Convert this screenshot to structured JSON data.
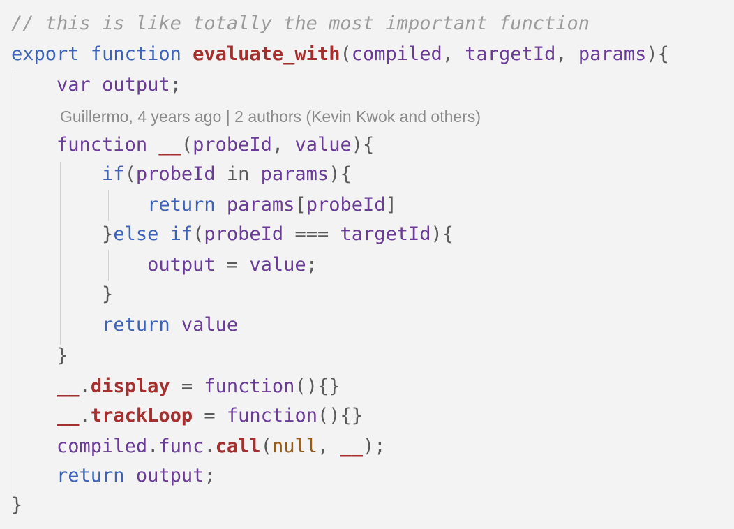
{
  "editor": {
    "blame_annotation": "Guillermo, 4 years ago | 2 authors (Kevin Kwok and others)",
    "lines": [
      [
        {
          "t": "// this is like totally the most important function",
          "c": "comment"
        }
      ],
      [
        {
          "t": "export",
          "c": "kw"
        },
        {
          "t": " ",
          "c": "punc"
        },
        {
          "t": "function",
          "c": "kw"
        },
        {
          "t": " ",
          "c": "punc"
        },
        {
          "t": "evaluate_with",
          "c": "fn"
        },
        {
          "t": "(",
          "c": "punc"
        },
        {
          "t": "compiled",
          "c": "var"
        },
        {
          "t": ", ",
          "c": "punc"
        },
        {
          "t": "targetId",
          "c": "var"
        },
        {
          "t": ", ",
          "c": "punc"
        },
        {
          "t": "params",
          "c": "var"
        },
        {
          "t": "){",
          "c": "punc"
        }
      ],
      [
        {
          "t": "    ",
          "c": "punc"
        },
        {
          "t": "var",
          "c": "var"
        },
        {
          "t": " ",
          "c": "punc"
        },
        {
          "t": "output",
          "c": "var"
        },
        {
          "t": ";",
          "c": "punc"
        }
      ],
      [
        {
          "t": "    ",
          "c": "punc"
        },
        {
          "t": "function",
          "c": "var"
        },
        {
          "t": " ",
          "c": "punc"
        },
        {
          "t": "__",
          "c": "under"
        },
        {
          "t": "(",
          "c": "punc"
        },
        {
          "t": "probeId",
          "c": "var"
        },
        {
          "t": ", ",
          "c": "punc"
        },
        {
          "t": "value",
          "c": "var"
        },
        {
          "t": "){",
          "c": "punc"
        }
      ],
      [
        {
          "t": "        ",
          "c": "punc"
        },
        {
          "t": "if",
          "c": "kw"
        },
        {
          "t": "(",
          "c": "punc"
        },
        {
          "t": "probeId",
          "c": "var"
        },
        {
          "t": " in ",
          "c": "punc"
        },
        {
          "t": "params",
          "c": "var"
        },
        {
          "t": "){",
          "c": "punc"
        }
      ],
      [
        {
          "t": "            ",
          "c": "punc"
        },
        {
          "t": "return",
          "c": "kw"
        },
        {
          "t": " ",
          "c": "punc"
        },
        {
          "t": "params",
          "c": "var"
        },
        {
          "t": "[",
          "c": "punc"
        },
        {
          "t": "probeId",
          "c": "var"
        },
        {
          "t": "]",
          "c": "punc"
        }
      ],
      [
        {
          "t": "        }",
          "c": "punc"
        },
        {
          "t": "else",
          "c": "kw"
        },
        {
          "t": " ",
          "c": "punc"
        },
        {
          "t": "if",
          "c": "kw"
        },
        {
          "t": "(",
          "c": "punc"
        },
        {
          "t": "probeId",
          "c": "var"
        },
        {
          "t": " === ",
          "c": "punc"
        },
        {
          "t": "targetId",
          "c": "var"
        },
        {
          "t": "){",
          "c": "punc"
        }
      ],
      [
        {
          "t": "            ",
          "c": "punc"
        },
        {
          "t": "output",
          "c": "var"
        },
        {
          "t": " = ",
          "c": "punc"
        },
        {
          "t": "value",
          "c": "var"
        },
        {
          "t": ";",
          "c": "punc"
        }
      ],
      [
        {
          "t": "        }",
          "c": "punc"
        }
      ],
      [
        {
          "t": "        ",
          "c": "punc"
        },
        {
          "t": "return",
          "c": "kw"
        },
        {
          "t": " ",
          "c": "punc"
        },
        {
          "t": "value",
          "c": "var"
        }
      ],
      [
        {
          "t": "    }",
          "c": "punc"
        }
      ],
      [
        {
          "t": "    ",
          "c": "punc"
        },
        {
          "t": "__",
          "c": "under"
        },
        {
          "t": ".",
          "c": "punc"
        },
        {
          "t": "display",
          "c": "fn"
        },
        {
          "t": " = ",
          "c": "punc"
        },
        {
          "t": "function",
          "c": "var"
        },
        {
          "t": "(){}",
          "c": "punc"
        }
      ],
      [
        {
          "t": "    ",
          "c": "punc"
        },
        {
          "t": "__",
          "c": "under"
        },
        {
          "t": ".",
          "c": "punc"
        },
        {
          "t": "trackLoop",
          "c": "fn"
        },
        {
          "t": " = ",
          "c": "punc"
        },
        {
          "t": "function",
          "c": "var"
        },
        {
          "t": "(){}",
          "c": "punc"
        }
      ],
      [
        {
          "t": "    ",
          "c": "punc"
        },
        {
          "t": "compiled",
          "c": "var"
        },
        {
          "t": ".",
          "c": "punc"
        },
        {
          "t": "func",
          "c": "var"
        },
        {
          "t": ".",
          "c": "punc"
        },
        {
          "t": "call",
          "c": "fn"
        },
        {
          "t": "(",
          "c": "punc"
        },
        {
          "t": "null",
          "c": "null"
        },
        {
          "t": ", ",
          "c": "punc"
        },
        {
          "t": "__",
          "c": "under"
        },
        {
          "t": ");",
          "c": "punc"
        }
      ],
      [
        {
          "t": "    ",
          "c": "punc"
        },
        {
          "t": "return",
          "c": "kw"
        },
        {
          "t": " ",
          "c": "punc"
        },
        {
          "t": "output",
          "c": "var"
        },
        {
          "t": ";",
          "c": "punc"
        }
      ],
      [
        {
          "t": "}",
          "c": "punc"
        }
      ]
    ]
  }
}
